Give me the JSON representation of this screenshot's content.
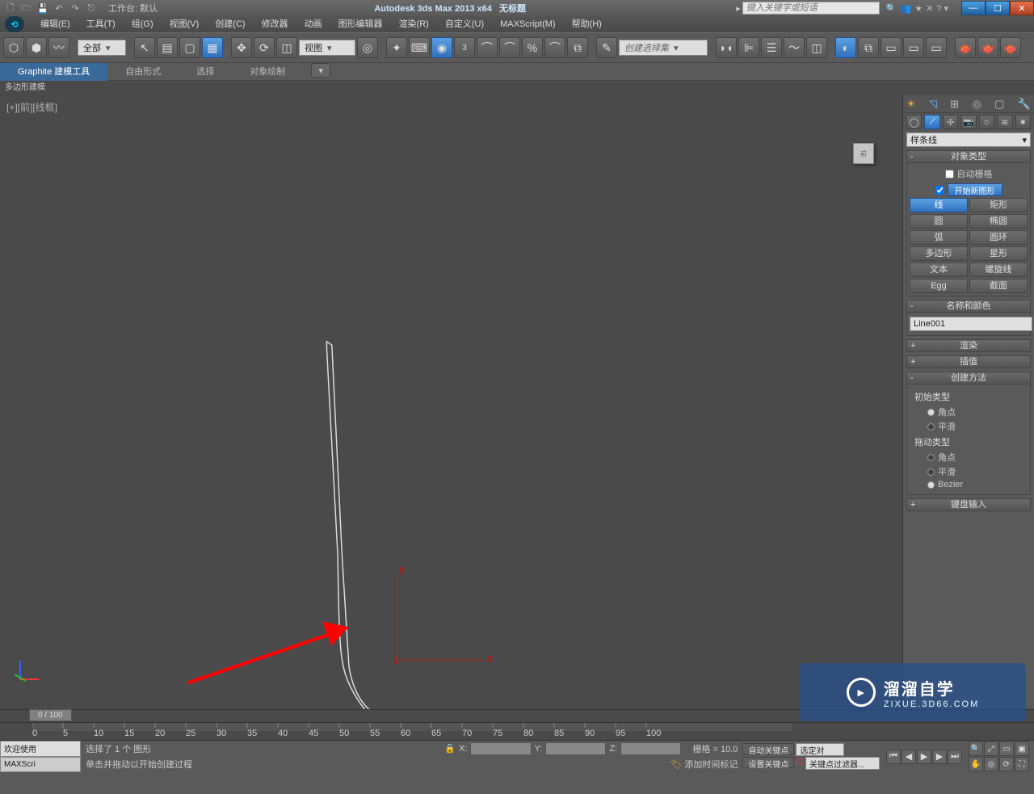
{
  "title": {
    "workspace_label": "工作台: 默认",
    "app": "Autodesk 3ds Max  2013 x64",
    "doc": "无标题",
    "search_placeholder": "键入关键字或短语"
  },
  "menu": [
    "编辑(E)",
    "工具(T)",
    "组(G)",
    "视图(V)",
    "创建(C)",
    "修改器",
    "动画",
    "图形编辑器",
    "渲染(R)",
    "自定义(U)",
    "MAXScript(M)",
    "帮助(H)"
  ],
  "toolbar": {
    "selection_filter": "全部",
    "ref_coord": "视图",
    "named_set_placeholder": "创建选择集"
  },
  "ribbon": {
    "tabs": [
      "Graphite 建模工具",
      "自由形式",
      "选择",
      "对象绘制"
    ],
    "active": 0,
    "sub": "多边形建模"
  },
  "viewport": {
    "label": "[+][前][线框]"
  },
  "panel": {
    "spline_combo": "样条线",
    "obj_type_title": "对象类型",
    "auto_grid": "自动栅格",
    "start_new": "开始新图形",
    "shapes": [
      [
        "线",
        "矩形"
      ],
      [
        "圆",
        "椭圆"
      ],
      [
        "弧",
        "圆环"
      ],
      [
        "多边形",
        "星形"
      ],
      [
        "文本",
        "螺旋线"
      ],
      [
        "Egg",
        "截面"
      ]
    ],
    "name_color_title": "名称和颜色",
    "obj_name": "Line001",
    "render_title": "渲染",
    "interp_title": "插值",
    "method_title": "创建方法",
    "init_type": "初始类型",
    "drag_type": "拖动类型",
    "opt_corner": "角点",
    "opt_smooth": "平滑",
    "opt_bezier": "Bezier",
    "keyboard_title": "键盘输入"
  },
  "track": {
    "pos": "0 / 100"
  },
  "status": {
    "welcome": "欢迎使用",
    "maxscript": "MAXScri",
    "sel_msg": "选择了 1 个 图形",
    "hint": "单击并拖动以开始创建过程",
    "x": "X:",
    "y": "Y:",
    "z": "Z:",
    "grid": "栅格 = 10.0",
    "add_time_tag": "添加时间标记",
    "auto_key": "自动关键点",
    "set_key": "设置关键点",
    "key_filter": "关键点过滤器...",
    "sel_set": "选定对"
  },
  "watermark": {
    "brand": "溜溜自学",
    "url": "ZIXUE.3D66.COM"
  }
}
